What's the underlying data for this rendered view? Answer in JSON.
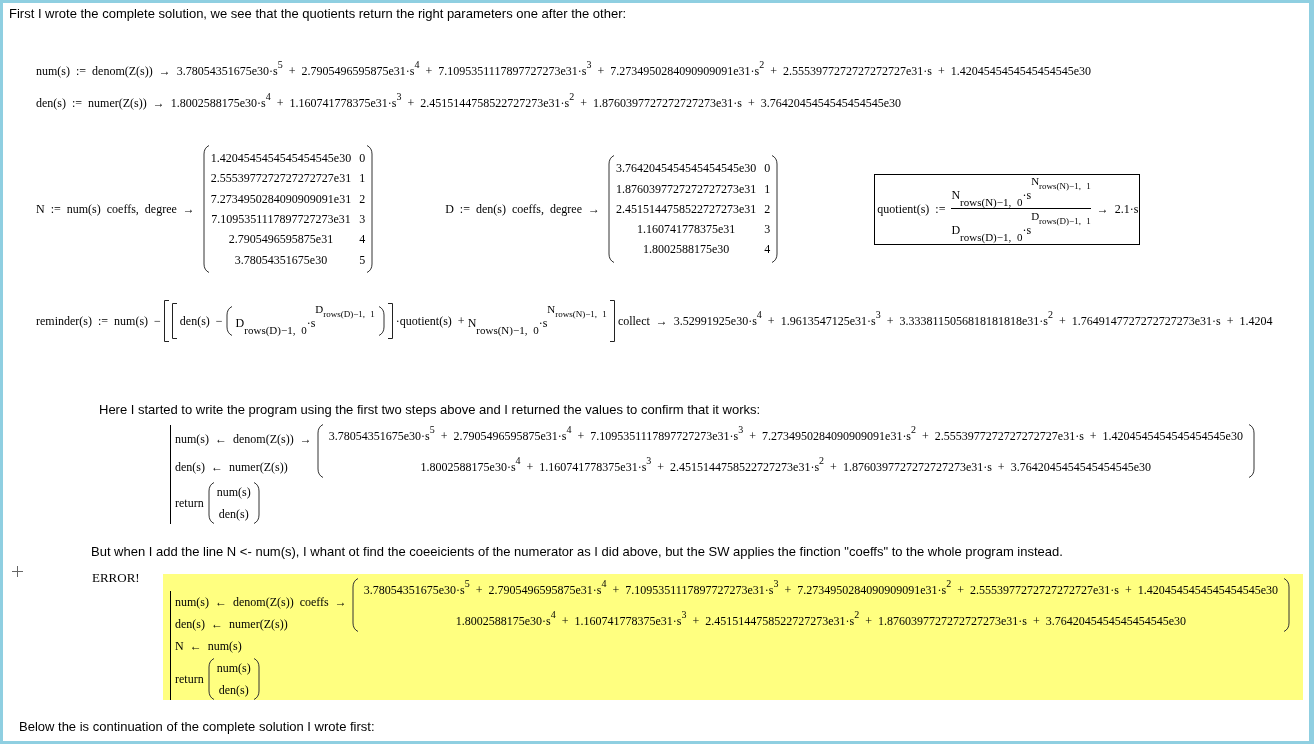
{
  "intro_comment": "First I wrote the complete solution, we see that the quotients return the right parameters one after the other:",
  "polynomials": [
    "num(s) := denom(Z(s)) → 3.78054351675e30·s$^{5}$ + 2.7905496595875e31·s$^{4}$ + 7.1095351117897727273e31·s$^{3}$ + 7.2734950284090909091e31·s$^{2}$ + 2.5553977272727272727e31·s + 1.4204545454545454545e30",
    "den(s) := numer(Z(s)) → 1.8002588175e30·s$^{4}$ + 1.160741778375e31·s$^{3}$ + 2.4515144758522727273e31·s$^{2}$ + 1.8760397727272727273e31·s + 3.7642045454545454545e30"
  ],
  "coefficient_matrices": [
    {
      "label": "N := num(s) coeffs, degree →",
      "rows": [
        [
          "1.4204545454545454545e30",
          "0"
        ],
        [
          "2.5553977272727272727e31",
          "1"
        ],
        [
          "7.2734950284090909091e31",
          "2"
        ],
        [
          "7.1095351117897727273e31",
          "3"
        ],
        [
          "2.7905496595875e31",
          "4"
        ],
        [
          "3.78054351675e30",
          "5"
        ]
      ]
    },
    {
      "label": "D := den(s) coeffs, degree →",
      "rows": [
        [
          "3.7642045454545454545e30",
          "0"
        ],
        [
          "1.8760397727272727273e31",
          "1"
        ],
        [
          "2.4515144758522727273e31",
          "2"
        ],
        [
          "1.160741778375e31",
          "3"
        ],
        [
          "1.8002588175e30",
          "4"
        ]
      ]
    }
  ],
  "quotient": {
    "lhs": "quotient(s) :=",
    "numerator": {
      "base": "N",
      "base_index": "rows(N)−1, 0",
      "factor": "·s",
      "exponent": "N",
      "exponent_index": "rows(N)−1, 1"
    },
    "denominator": {
      "base": "D",
      "base_index": "rows(D)−1, 0",
      "factor": "·s",
      "exponent": "D",
      "exponent_index": "rows(D)−1, 1"
    },
    "result": "→ 2.1·s"
  },
  "reminder": [
    {
      "kind": "text",
      "text": "reminder(s) := num(s) −"
    },
    {
      "kind": "bracket_open"
    },
    {
      "kind": "bracket_open"
    },
    {
      "kind": "text",
      "text": "den(s) −"
    },
    {
      "kind": "paren_open"
    },
    {
      "kind": "power",
      "base": "D",
      "base_index": "rows(D)−1, 0",
      "factor": "·s",
      "exponent": "D",
      "exponent_index": "rows(D)−1, 1"
    },
    {
      "kind": "paren_close"
    },
    {
      "kind": "bracket_close"
    },
    {
      "kind": "text",
      "text": "·quotient(s) +"
    },
    {
      "kind": "power",
      "base": "N",
      "base_index": "rows(N)−1, 0",
      "factor": "·s",
      "exponent": "N",
      "exponent_index": "rows(N)−1, 1"
    },
    {
      "kind": "bracket_close"
    },
    {
      "kind": "text",
      "text": "collect → 3.52991925e30·s$^{4}$ + 1.9613547125e31·s$^{3}$ + 3.3338115056818181818e31·s$^{2}$ + 1.7649147727272727273e31·s + 1.4204"
    }
  ],
  "programs": [
    {
      "comment": "Here I started to write the program using the first two steps above and I returned the values to confirm that it works:",
      "error": false,
      "lines": [
        "num(s) ← denom(Z(s))",
        "den(s) ← numer(Z(s))"
      ],
      "return_keyword": "return",
      "return_values": [
        "num(s)",
        "den(s)"
      ],
      "operator": "→",
      "result": [
        "3.78054351675e30·s$^{5}$ + 2.7905496595875e31·s$^{4}$ + 7.1095351117897727273e31·s$^{3}$ + 7.2734950284090909091e31·s$^{2}$ + 2.5553977272727272727e31·s + 1.4204545454545454545e30",
        "1.8002588175e30·s$^{4}$ + 1.160741778375e31·s$^{3}$ + 2.4515144758522727273e31·s$^{2}$ + 1.8760397727272727273e31·s + 3.7642045454545454545e30"
      ]
    },
    {
      "comment": "But when I add the line N <- num(s), I whant ot find the coeeicients of the numerator as I did above, but the SW applies the finction \"coeffs\" to the whole program instead.",
      "error": true,
      "error_label": "ERROR!",
      "lines": [
        "num(s) ← denom(Z(s))",
        "den(s) ← numer(Z(s))",
        "N ← num(s)"
      ],
      "return_keyword": "return",
      "return_values": [
        "num(s)",
        "den(s)"
      ],
      "operator": "coeffs →",
      "result": [
        "3.78054351675e30·s$^{5}$ + 2.7905496595875e31·s$^{4}$ + 7.1095351117897727273e31·s$^{3}$ + 7.2734950284090909091e31·s$^{2}$ + 2.5553977272727272727e31·s + 1.4204545454545454545e30",
        "1.8002588175e30·s$^{4}$ + 1.160741778375e31·s$^{3}$ + 2.4515144758522727273e31·s$^{2}$ + 1.8760397727272727273e31·s + 3.7642045454545454545e30"
      ]
    }
  ],
  "closing_comment": "Below the is continuation of the complete solution I wrote first:"
}
